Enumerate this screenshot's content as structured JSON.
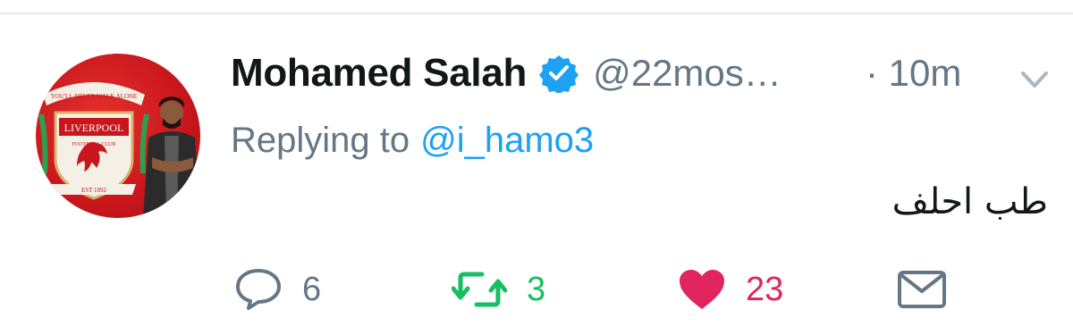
{
  "tweet": {
    "author": {
      "display_name": "Mohamed Salah",
      "handle": "@22mos…",
      "verified": true,
      "avatar": {
        "description": "Liverpool FC crest with player photo on red background",
        "crest_text": {
          "motto": "YOU'LL NEVER WALK ALONE",
          "club": "LIVERPOOL",
          "subtitle": "FOOTBALL CLUB",
          "established": "EST 1892"
        }
      }
    },
    "timestamp": "· 10m",
    "replying_to": {
      "prefix": "Replying to",
      "mention": "@i_hamo3"
    },
    "text": "طب احلف",
    "actions": {
      "reply": {
        "icon": "reply-icon",
        "count": "6"
      },
      "retweet": {
        "icon": "retweet-icon",
        "count": "3"
      },
      "like": {
        "icon": "heart-icon",
        "count": "23",
        "liked": true
      },
      "message": {
        "icon": "envelope-icon"
      }
    }
  },
  "colors": {
    "primary_text": "#14171a",
    "secondary_text": "#657786",
    "link": "#1da1f2",
    "verified": "#1da1f2",
    "retweet": "#17bf63",
    "like": "#e0245e",
    "divider": "#e1e8ed",
    "avatar_bg": "#c8161c"
  }
}
